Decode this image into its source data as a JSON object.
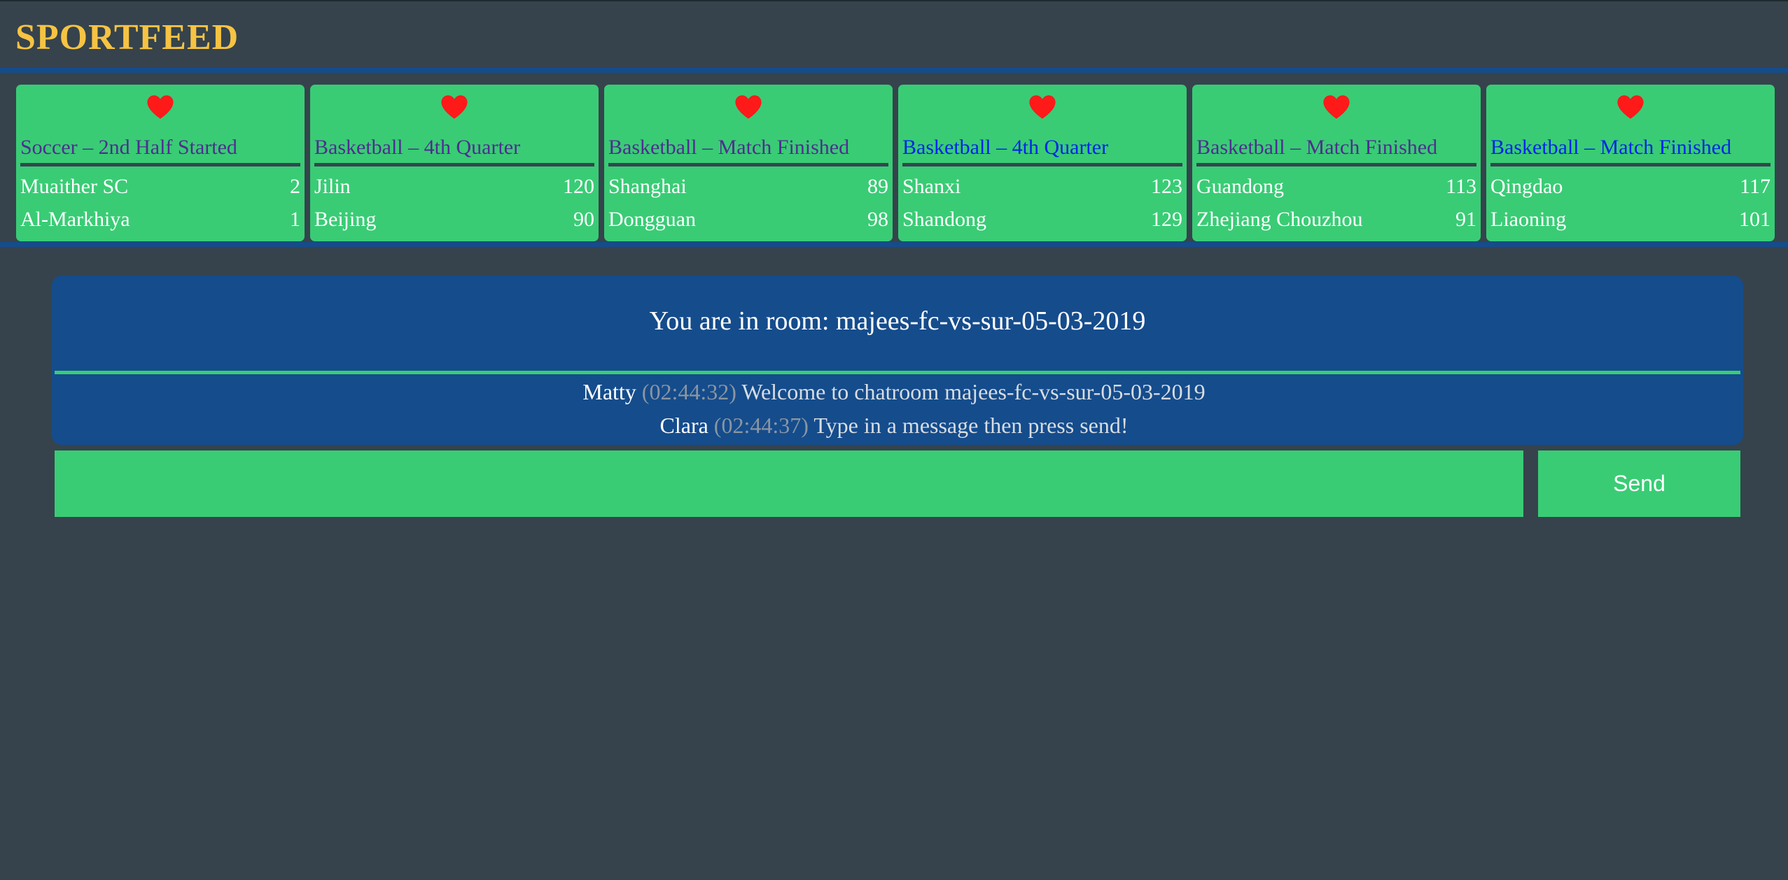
{
  "app": {
    "brand": "SPORTFEED"
  },
  "colors": {
    "background": "#36434c",
    "brand": "#f6c343",
    "card": "#39cc75",
    "accent_blue": "#154c8c",
    "heart": "#ff1a1a",
    "status_finished": "#4e2e8f",
    "status_live": "#0026e8"
  },
  "icons": {
    "favorite": "heart-icon"
  },
  "matches": [
    {
      "status": "Soccer – 2nd Half Started",
      "home": {
        "name": "Muaither SC",
        "score": "2"
      },
      "away": {
        "name": "Al-Markhiya",
        "score": "1"
      }
    },
    {
      "status": "Basketball – 4th Quarter",
      "home": {
        "name": "Jilin",
        "score": "120"
      },
      "away": {
        "name": "Beijing",
        "score": "90"
      }
    },
    {
      "status": "Basketball – Match Finished",
      "home": {
        "name": "Shanghai",
        "score": "89"
      },
      "away": {
        "name": "Dongguan",
        "score": "98"
      }
    },
    {
      "status": "Basketball – 4th Quarter",
      "home": {
        "name": "Shanxi",
        "score": "123"
      },
      "away": {
        "name": "Shandong",
        "score": "129"
      }
    },
    {
      "status": "Basketball – Match Finished",
      "home": {
        "name": "Guandong",
        "score": "113"
      },
      "away": {
        "name": "Zhejiang Chouzhou",
        "score": "91"
      }
    },
    {
      "status": "Basketball – Match Finished",
      "home": {
        "name": "Qingdao",
        "score": "117"
      },
      "away": {
        "name": "Liaoning",
        "score": "101"
      }
    }
  ],
  "chat": {
    "room_title": "You are in room: majees-fc-vs-sur-05-03-2019",
    "messages": [
      {
        "author": "Matty",
        "time": "(02:44:32)",
        "text": "Welcome to chatroom majees-fc-vs-sur-05-03-2019"
      },
      {
        "author": "Clara",
        "time": "(02:44:37)",
        "text": "Type in a message then press send!"
      }
    ],
    "input_value": "",
    "send_label": "Send"
  }
}
